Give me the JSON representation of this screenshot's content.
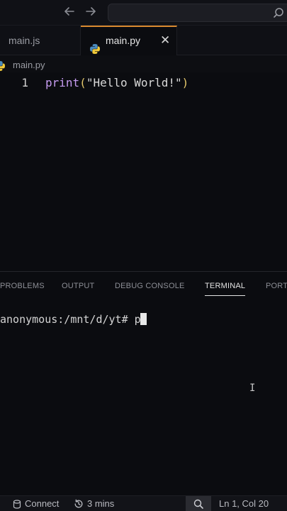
{
  "titlebar": {
    "back_icon": "arrow-left-icon",
    "forward_icon": "arrow-right-icon",
    "search_placeholder": "",
    "search_icon": "search-icon"
  },
  "tabs": [
    {
      "label": "main.js",
      "active": false
    },
    {
      "label": "main.py",
      "active": true,
      "close_glyph": "✕"
    }
  ],
  "breadcrumb": {
    "file": "main.py"
  },
  "editor": {
    "line_number": "1",
    "code": {
      "fn": "print",
      "open": "(",
      "str": "\"Hello World!\"",
      "close": ")"
    }
  },
  "panel": {
    "tabs": [
      "PROBLEMS",
      "OUTPUT",
      "DEBUG CONSOLE",
      "TERMINAL",
      "PORTS"
    ],
    "active_tab": "TERMINAL",
    "terminal_prompt": "anonymous:/mnt/d/yt# ",
    "terminal_input": "p"
  },
  "statusbar": {
    "connect": "Connect",
    "time": "3 mins",
    "position": "Ln 1, Col 20"
  },
  "colors": {
    "accent_tab_border": "#d98a2f",
    "keyword_fn": "#c69cf0",
    "paren": "#e3c76b",
    "background": "#0b0c10"
  }
}
